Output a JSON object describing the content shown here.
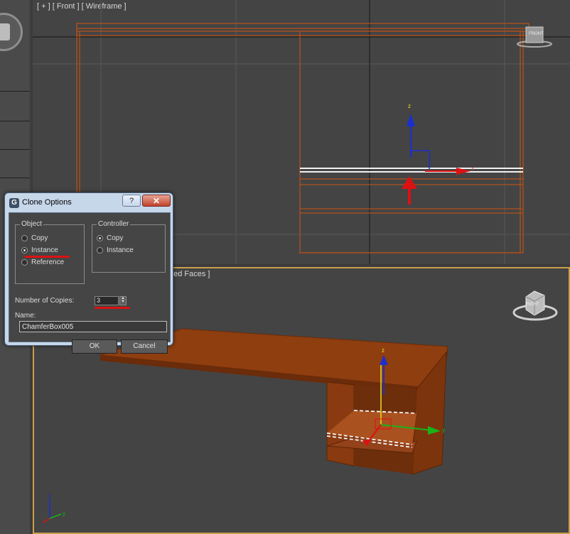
{
  "viewports": {
    "front": {
      "label": "[ + ] [ Front ] [ Wireframe ]",
      "viewcube_label": "FRONT"
    },
    "perspective": {
      "label_fragment": "ged Faces ]",
      "viewcube_label": "RIGHT"
    }
  },
  "gizmo": {
    "z_label": "z",
    "x_label": "x",
    "y_label": "y"
  },
  "dialog": {
    "title": "Clone Options",
    "help_label": "?",
    "close_label": "✕",
    "object_group": {
      "title": "Object",
      "options": [
        "Copy",
        "Instance",
        "Reference"
      ],
      "selected": "Instance"
    },
    "controller_group": {
      "title": "Controller",
      "options": [
        "Copy",
        "Instance"
      ],
      "selected": "Copy"
    },
    "copies_label": "Number of Copies:",
    "copies_value": "3",
    "name_label": "Name:",
    "name_value": "ChamferBox005",
    "ok_label": "OK",
    "cancel_label": "Cancel"
  },
  "colors": {
    "wire_orange": "#b3501a",
    "annotation_red": "#dd1111",
    "axis_blue": "#1a2fd0",
    "axis_green": "#19b319",
    "viewport_bg": "#444444",
    "active_border": "#c9a04a"
  }
}
